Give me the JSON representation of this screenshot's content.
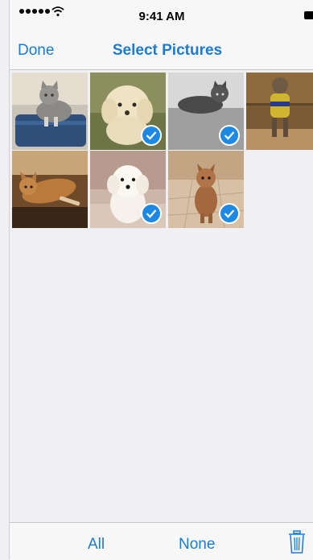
{
  "status_bar": {
    "time": "9:41 AM",
    "signal_icon": "signal-dots-icon",
    "wifi_icon": "wifi-icon",
    "battery_icon": "battery-icon"
  },
  "nav": {
    "done_label": "Done",
    "title": "Select Pictures"
  },
  "photos": [
    {
      "subject": "gray tabby cat on blue suitcase",
      "selected": false,
      "active": true
    },
    {
      "subject": "fluffy white poodle",
      "selected": true,
      "active": false
    },
    {
      "subject": "tabby cat lying on floor",
      "selected": true,
      "active": false
    },
    {
      "subject": "small dog in sweater",
      "selected": false,
      "active": false
    },
    {
      "subject": "cat stretching on couch",
      "selected": false,
      "active": false
    },
    {
      "subject": "white bichon dog",
      "selected": true,
      "active": false
    },
    {
      "subject": "yorkie on tile floor",
      "selected": true,
      "active": false
    }
  ],
  "toolbar": {
    "all_label": "All",
    "none_label": "None",
    "trash_icon": "trash-icon"
  },
  "colors": {
    "accent": "#1b7bd4",
    "check": "#1e88e5",
    "background": "#efeff4"
  }
}
